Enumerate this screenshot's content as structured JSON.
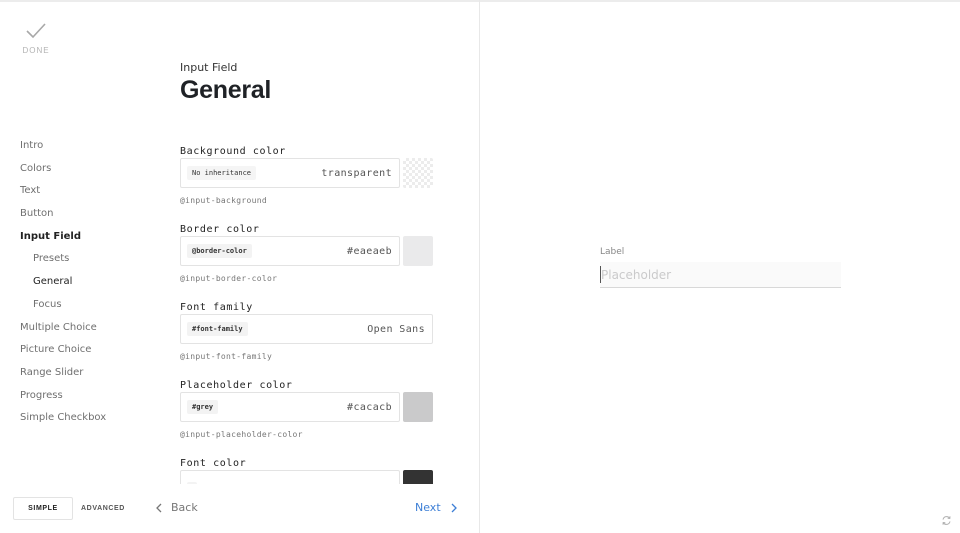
{
  "done": {
    "label": "DONE",
    "icon": "checkmark-icon"
  },
  "nav": {
    "items": [
      {
        "label": "Intro",
        "level": 0,
        "state": "normal"
      },
      {
        "label": "Colors",
        "level": 0,
        "state": "normal"
      },
      {
        "label": "Text",
        "level": 0,
        "state": "normal"
      },
      {
        "label": "Button",
        "level": 0,
        "state": "normal"
      },
      {
        "label": "Input Field",
        "level": 0,
        "state": "active"
      },
      {
        "label": "Presets",
        "level": 1,
        "state": "normal"
      },
      {
        "label": "General",
        "level": 1,
        "state": "current"
      },
      {
        "label": "Focus",
        "level": 1,
        "state": "normal"
      },
      {
        "label": "Multiple Choice",
        "level": 0,
        "state": "normal"
      },
      {
        "label": "Picture Choice",
        "level": 0,
        "state": "normal"
      },
      {
        "label": "Range Slider",
        "level": 0,
        "state": "normal"
      },
      {
        "label": "Progress",
        "level": 0,
        "state": "normal"
      },
      {
        "label": "Simple Checkbox",
        "level": 0,
        "state": "normal"
      }
    ]
  },
  "header": {
    "section": "Input Field",
    "title": "General"
  },
  "fields": [
    {
      "label": "Background color",
      "chip": "No inheritance",
      "value": "transparent",
      "var": "@input-background",
      "swatch": "transparent"
    },
    {
      "label": "Border color",
      "chip": "@border-color",
      "value": "#eaeaeb",
      "var": "@input-border-color",
      "swatch": "#eaeaeb"
    },
    {
      "label": "Font family",
      "chip": "#font-family",
      "value": "Open Sans",
      "var": "@input-font-family",
      "swatch": null
    },
    {
      "label": "Placeholder color",
      "chip": "#grey",
      "value": "#cacacb",
      "var": "@input-placeholder-color",
      "swatch": "#cacacb"
    },
    {
      "label": "Font color",
      "chip": "",
      "value": "",
      "var": "",
      "swatch": "#333333"
    }
  ],
  "bottom": {
    "simple_label": "SIMPLE",
    "advanced_label": "ADVANCED",
    "back_label": "Back",
    "next_label": "Next"
  },
  "preview": {
    "label": "Label",
    "placeholder": "Placeholder"
  },
  "colors": {
    "accent": "#3d7fd6",
    "divider": "#e8e8e8"
  }
}
